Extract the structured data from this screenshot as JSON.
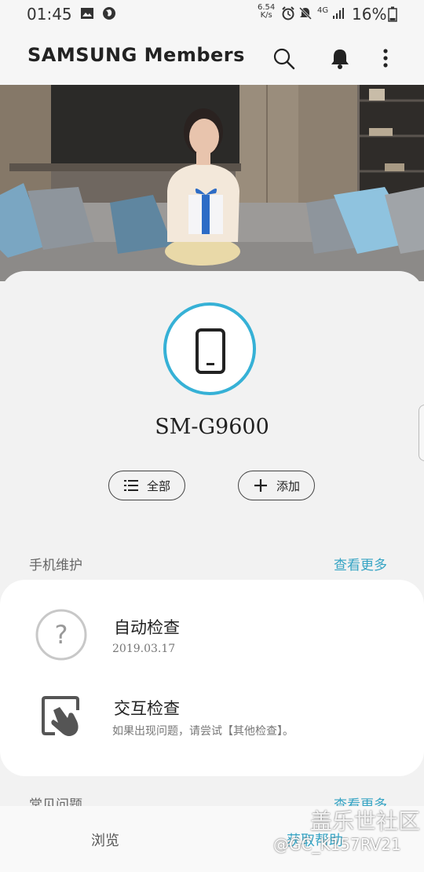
{
  "status_bar": {
    "time": "01:45",
    "net_speed_top": "6.54",
    "net_speed_bottom": "K/s",
    "network": "4G",
    "battery": "16%"
  },
  "app_bar": {
    "title": "SAMSUNG Members",
    "icons": [
      "search-icon",
      "bell-icon",
      "more-vert-icon"
    ]
  },
  "device": {
    "model": "SM-G9600",
    "all_button": "全部",
    "add_button": "添加"
  },
  "maintenance": {
    "title": "手机维护",
    "see_more": "查看更多",
    "items": [
      {
        "title": "自动检查",
        "subtitle": "2019.03.17",
        "icon": "question-icon"
      },
      {
        "title": "交互检查",
        "subtitle": "如果出现问题，请尝试【其他检查】。",
        "icon": "touch-icon"
      }
    ]
  },
  "faq": {
    "title": "常见问题",
    "see_more": "查看更多"
  },
  "bottom_nav": {
    "browse": "浏览",
    "get_help": "获取帮助"
  },
  "watermark": {
    "line1": "盖乐世社区",
    "line2": "@GC_K157RV21"
  },
  "colors": {
    "accent": "#36b1d6",
    "link": "#36a4c4"
  }
}
